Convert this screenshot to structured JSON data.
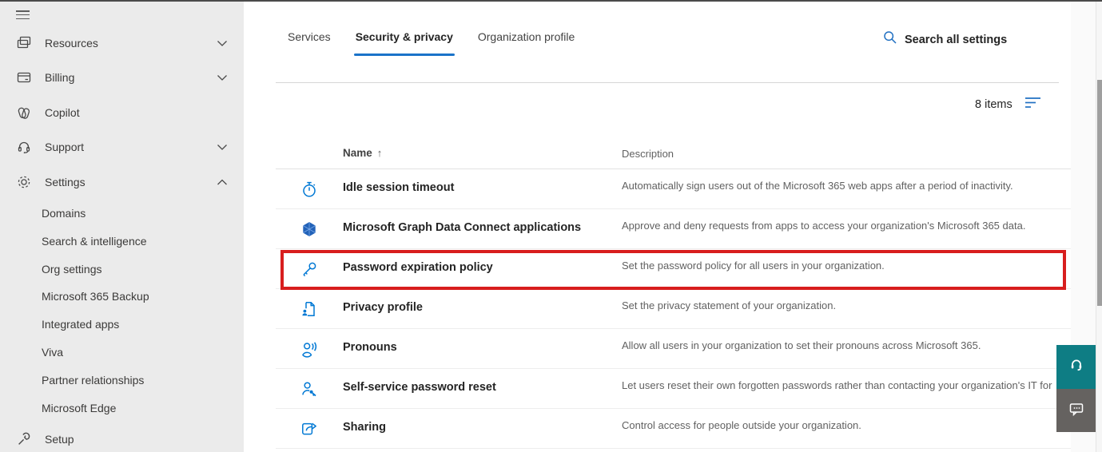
{
  "colors": {
    "accent_blue": "#0078d4",
    "tab_underline": "#1a73c9",
    "highlight_red": "#d81e1e",
    "help_button_teal": "#0e7d84",
    "feedback_button_gray": "#656260",
    "sidebar_bg": "#ebebeb"
  },
  "sidebar": {
    "menu_icon": "hamburger-icon",
    "items": [
      {
        "label": "Resources",
        "icon": "resources-icon",
        "chevron": "down"
      },
      {
        "label": "Billing",
        "icon": "billing-icon",
        "chevron": "down"
      },
      {
        "label": "Copilot",
        "icon": "copilot-icon",
        "chevron": "none"
      },
      {
        "label": "Support",
        "icon": "support-icon",
        "chevron": "down"
      },
      {
        "label": "Settings",
        "icon": "gear-icon",
        "chevron": "up",
        "expanded": true
      }
    ],
    "settings_children": [
      "Domains",
      "Search & intelligence",
      "Org settings",
      "Microsoft 365 Backup",
      "Integrated apps",
      "Viva",
      "Partner relationships",
      "Microsoft Edge"
    ],
    "setup": {
      "label": "Setup",
      "icon": "wrench-icon"
    }
  },
  "tabs": [
    {
      "label": "Services",
      "active": false
    },
    {
      "label": "Security & privacy",
      "active": true
    },
    {
      "label": "Organization profile",
      "active": false
    }
  ],
  "search": {
    "label": "Search all settings",
    "icon": "search-icon"
  },
  "list": {
    "count_label": "8 items",
    "filter_icon": "filter-icon",
    "columns": {
      "name": "Name",
      "description": "Description"
    },
    "sort_glyph": "↑",
    "rows": [
      {
        "icon": "stopwatch-icon",
        "name": "Idle session timeout",
        "description": "Automatically sign users out of the Microsoft 365 web apps after a period of inactivity.",
        "highlighted": false
      },
      {
        "icon": "graph-icon",
        "name": "Microsoft Graph Data Connect applications",
        "description": "Approve and deny requests from apps to access your organization's Microsoft 365 data.",
        "highlighted": false
      },
      {
        "icon": "key-icon",
        "name": "Password expiration policy",
        "description": "Set the password policy for all users in your organization.",
        "highlighted": true
      },
      {
        "icon": "privacy-profile-icon",
        "name": "Privacy profile",
        "description": "Set the privacy statement of your organization.",
        "highlighted": false
      },
      {
        "icon": "pronouns-icon",
        "name": "Pronouns",
        "description": "Allow all users in your organization to set their pronouns across Microsoft 365.",
        "highlighted": false
      },
      {
        "icon": "person-key-icon",
        "name": "Self-service password reset",
        "description": "Let users reset their own forgotten passwords rather than contacting your organization's IT for",
        "highlighted": false
      },
      {
        "icon": "share-icon",
        "name": "Sharing",
        "description": "Control access for people outside your organization.",
        "highlighted": false
      }
    ]
  },
  "floating_buttons": [
    {
      "name": "help",
      "icon": "headset-icon"
    },
    {
      "name": "feedback",
      "icon": "chat-icon"
    }
  ]
}
